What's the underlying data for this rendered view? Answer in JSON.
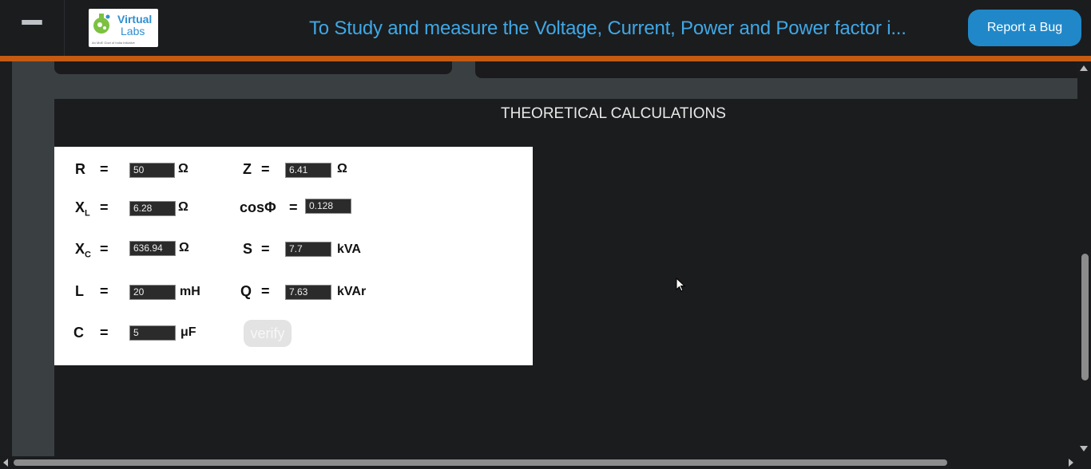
{
  "header": {
    "logo": {
      "word1": "Virtual",
      "word2": "Labs",
      "tagline": "An MoE Govt of India Initiative"
    },
    "title": "To Study and measure the Voltage, Current, Power and Power factor i...",
    "report_bug": "Report a Bug"
  },
  "calculations": {
    "heading": "THEORETICAL CALCULATIONS",
    "left": [
      {
        "label": "R",
        "eq": "=",
        "value": "50",
        "unit": "Ω"
      },
      {
        "label": "X",
        "sub": "L",
        "eq": "=",
        "value": "6.28",
        "unit": "Ω"
      },
      {
        "label": "X",
        "sub": "C",
        "eq": "=",
        "value": "636.94",
        "unit": "Ω"
      },
      {
        "label": "L",
        "eq": "=",
        "value": "20",
        "unit": "mH"
      },
      {
        "label": "C",
        "eq": "=",
        "value": "5",
        "unit": "μF"
      }
    ],
    "right": [
      {
        "label": "Z",
        "eq": "=",
        "value": "6.41",
        "unit": "Ω"
      },
      {
        "label": "cosΦ",
        "eq": "=",
        "value": "0.128",
        "unit": ""
      },
      {
        "label": "S",
        "eq": "=",
        "value": "7.7",
        "unit": "kVA"
      },
      {
        "label": "Q",
        "eq": "=",
        "value": "7.63",
        "unit": "kVAr"
      }
    ],
    "verify_label": "verify"
  },
  "colors": {
    "accent": "#3fa8e6",
    "button": "#2088c9",
    "divider": "#c55a11"
  }
}
